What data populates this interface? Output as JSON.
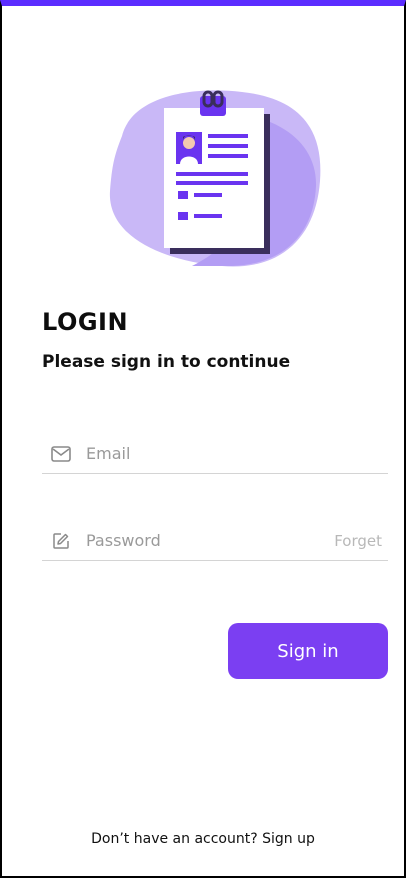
{
  "header": {
    "title": "LOGIN",
    "subtitle": "Please sign in to continue"
  },
  "illustration": {
    "icon": "resume-clipboard-illustration",
    "colors": {
      "blob": "#c9b8f7",
      "blob_shadow": "#a58cf2",
      "paper": "#ffffff",
      "accent": "#6a34f0",
      "clip": "#3a2e5c"
    }
  },
  "form": {
    "email": {
      "icon": "mail-icon",
      "placeholder": "Email",
      "value": ""
    },
    "password": {
      "icon": "edit-icon",
      "placeholder": "Password",
      "value": "",
      "forget_label": "Forget"
    },
    "submit_label": "Sign in"
  },
  "footer": {
    "prompt": "Don’t have an account?",
    "signup_label": "Sign up"
  },
  "colors": {
    "accent": "#7b3ff2",
    "top_bar": "#5b2cff",
    "divider": "#d4d4d4",
    "muted": "#9a9a9a"
  }
}
